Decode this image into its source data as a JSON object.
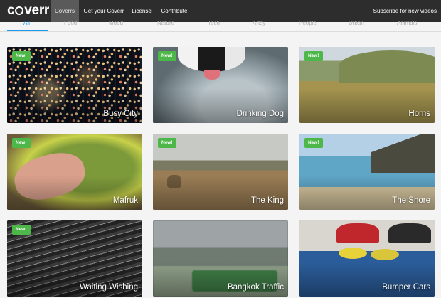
{
  "header": {
    "logo_text_pre": "c",
    "logo_text_post": "verr",
    "nav": [
      {
        "label": "Coverrs",
        "active": true
      },
      {
        "label": "Get your Coverr",
        "active": false
      },
      {
        "label": "License",
        "active": false
      },
      {
        "label": "Contribute",
        "active": false
      }
    ],
    "subscribe_label": "Subscribe for new videos"
  },
  "categories": [
    {
      "label": "All",
      "active": true
    },
    {
      "label": "Food",
      "active": false
    },
    {
      "label": "Mood",
      "active": false
    },
    {
      "label": "Nature",
      "active": false
    },
    {
      "label": "Tech",
      "active": false
    },
    {
      "label": "Artsy",
      "active": false
    },
    {
      "label": "People",
      "active": false
    },
    {
      "label": "Urban",
      "active": false
    },
    {
      "label": "Animals",
      "active": false
    }
  ],
  "badge_label": "New!",
  "videos": [
    {
      "title": "Busy City",
      "new": true
    },
    {
      "title": "Drinking Dog",
      "new": true
    },
    {
      "title": "Horns",
      "new": true
    },
    {
      "title": "Mafruk",
      "new": true
    },
    {
      "title": "The King",
      "new": true
    },
    {
      "title": "The Shore",
      "new": true
    },
    {
      "title": "Waiting Wishing",
      "new": true
    },
    {
      "title": "Bangkok Traffic",
      "new": false
    },
    {
      "title": "Bumper Cars",
      "new": false
    }
  ],
  "colors": {
    "topbar": "#2d2d2d",
    "active_nav": "#5a5a5a",
    "accent": "#1d9bf0",
    "badge": "#4db849"
  }
}
